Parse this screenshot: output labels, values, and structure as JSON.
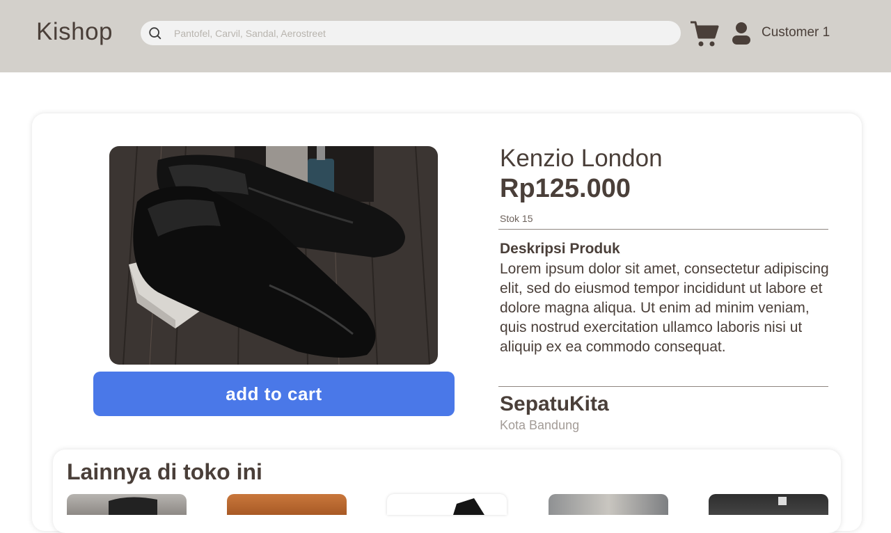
{
  "header": {
    "logo": "Kishop",
    "search": {
      "placeholder": "Pantofel, Carvil, Sandal, Aerostreet",
      "icon": "search-icon"
    },
    "cart_icon": "cart-icon",
    "user": {
      "icon": "user-icon",
      "name": "Customer 1"
    }
  },
  "product": {
    "name": "Kenzio London",
    "price": "Rp125.000",
    "stock": "Stok 15",
    "description_title": "Deskripsi Produk",
    "description": "Lorem ipsum dolor sit amet, consectetur adipiscing elit, sed do eiusmod tempor incididunt ut labore et dolore magna aliqua. Ut enim ad minim veniam, quis nostrud exercitation ullamco laboris nisi ut aliquip ex ea commodo consequat.",
    "add_to_cart_label": "add to cart"
  },
  "store": {
    "name": "SepatuKita",
    "city": "Kota Bandung"
  },
  "more_from_store": {
    "title": "Lainnya di toko ini"
  },
  "colors": {
    "header_bg": "#d3d0cb",
    "text": "#4a3f39",
    "button": "#4a78e8"
  }
}
